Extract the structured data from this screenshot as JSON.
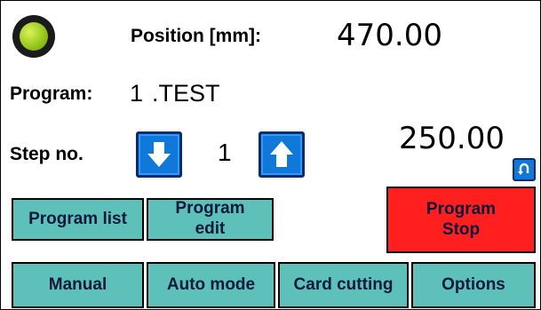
{
  "status": {
    "indicator_color": "#98c81e"
  },
  "position": {
    "label": "Position  [mm]:",
    "value": "470.00"
  },
  "program": {
    "label": "Program:",
    "number": "1",
    "name": ".TEST"
  },
  "step": {
    "label": "Step no.",
    "value": "1",
    "target_value": "250.00"
  },
  "buttons": {
    "program_list": "Program list",
    "program_edit_line1": "Program",
    "program_edit_line2": "edit",
    "program_stop_line1": "Program",
    "program_stop_line2": "Stop",
    "manual": "Manual",
    "auto_mode": "Auto mode",
    "card_cutting": "Card cutting",
    "options": "Options"
  },
  "icons": {
    "step_down": "arrow-down-icon",
    "step_up": "arrow-up-icon",
    "reset": "return-icon"
  },
  "colors": {
    "button": "#5ec1b9",
    "stop": "#ff1f1f",
    "arrow_button": "#0f78d8"
  }
}
